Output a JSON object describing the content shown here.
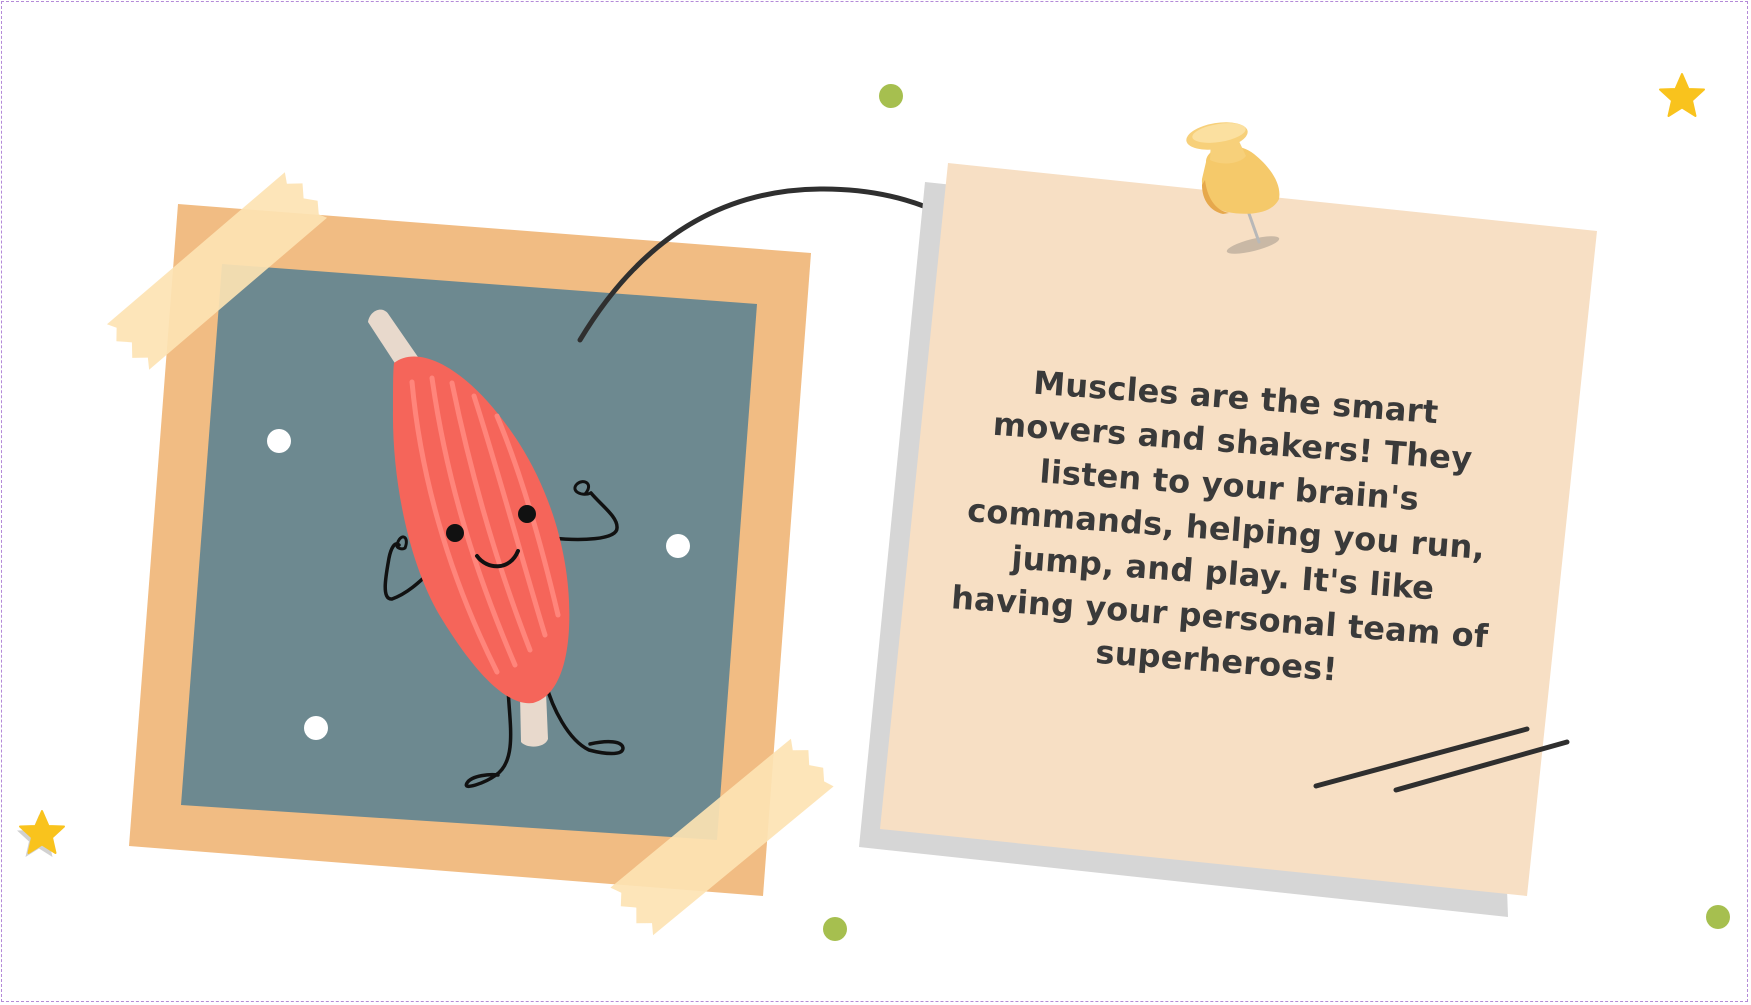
{
  "note": {
    "text": "Muscles are the smart movers and shakers! They listen to your brain's commands, helping you run, jump, and play. It's like having your personal team of superheroes!"
  },
  "colors": {
    "frame": "#f1bc83",
    "photo_background": "#6d8990",
    "tape": "#fde3b3",
    "note_paper": "#f7dfc4",
    "note_shadow": "#d6d6d6",
    "muscle_red": "#f5655a",
    "muscle_stripe": "#ff857b",
    "tendon": "#e8d9cc",
    "pin_yellow": "#f5c96a",
    "star_yellow": "#f9c31d",
    "confetti_green": "#a6bf4f",
    "ink": "#2f2f2f"
  },
  "icons": [
    "muscle-character-illustration",
    "push-pin-icon",
    "curved-arrow-icon",
    "star-icon",
    "masking-tape"
  ]
}
